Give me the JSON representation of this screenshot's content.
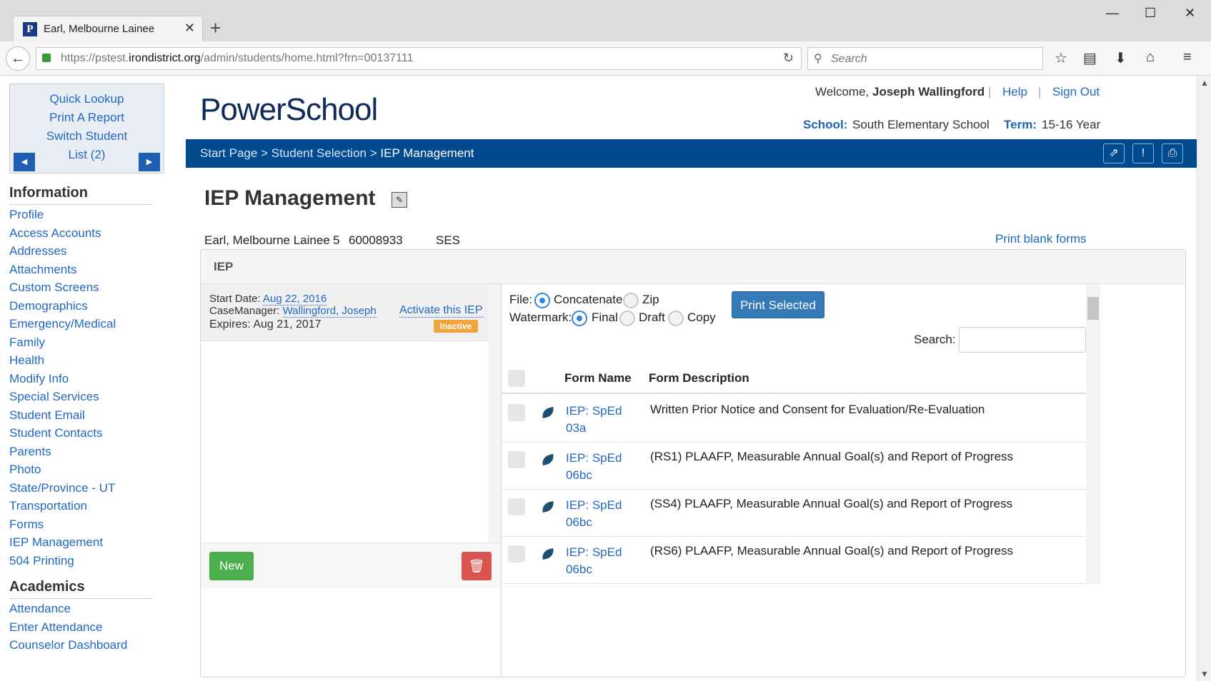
{
  "browser": {
    "tab_title": "Earl, Melbourne Lainee",
    "url_prefix": "https://pstest.",
    "url_domain": "irondistrict.org",
    "url_path": "/admin/students/home.html?frn=00137111",
    "search_placeholder": "Search"
  },
  "sidebar": {
    "quick_lookup": "Quick Lookup",
    "print_report": "Print A Report",
    "switch_student": "Switch Student",
    "list": "List (2)",
    "information_heading": "Information",
    "information_links": [
      "Profile",
      "Access Accounts",
      "Addresses",
      "Attachments",
      "Custom Screens",
      "Demographics",
      "Emergency/Medical",
      "Family",
      "Health",
      "Modify Info",
      "Special Services",
      "Student Email",
      "Student Contacts",
      "Parents",
      "Photo",
      "State/Province - UT",
      "Transportation",
      "Forms",
      "IEP Management",
      "504 Printing"
    ],
    "academics_heading": "Academics",
    "academics_links": [
      "Attendance",
      "Enter Attendance",
      "Counselor Dashboard"
    ]
  },
  "header": {
    "logo": "PowerSchool",
    "welcome": "Welcome,",
    "user": "Joseph Wallingford",
    "help": "Help",
    "sign_out": "Sign Out",
    "school_label": "School:",
    "school_value": "South Elementary School",
    "term_label": "Term:",
    "term_value": "15-16 Year"
  },
  "breadcrumb": {
    "start": "Start Page",
    "selection": "Student Selection",
    "current": "IEP Management",
    "sep": ">"
  },
  "page": {
    "title": "IEP Management",
    "student_name": "Earl, Melbourne Lainee",
    "grade": "5",
    "student_number": "60008933",
    "school_abbr": "SES",
    "print_blank": "Print blank forms",
    "panel_title": "IEP"
  },
  "iep": {
    "start_label": "Start Date:",
    "start_value": "Aug 22, 2016",
    "cm_label": "CaseManager:",
    "cm_value": "Wallingford, Joseph",
    "expires": "Expires: Aug 21, 2017",
    "activate": "Activate this IEP",
    "status": "Inactive",
    "new_button": "New"
  },
  "options": {
    "file_label": "File:",
    "concatenate": "Concatenate",
    "zip": "Zip",
    "watermark_label": "Watermark:",
    "final": "Final",
    "draft": "Draft",
    "copy": "Copy",
    "print_selected": "Print Selected",
    "search_label": "Search:"
  },
  "table": {
    "col_name": "Form Name",
    "col_desc": "Form Description",
    "rows": [
      {
        "name": "IEP: SpEd 03a",
        "desc": "Written Prior Notice and Consent for Evaluation/Re-Evaluation"
      },
      {
        "name": "IEP: SpEd 06bc",
        "desc": "(RS1) PLAAFP, Measurable Annual Goal(s) and Report of Progress"
      },
      {
        "name": "IEP: SpEd 06bc",
        "desc": "(SS4) PLAAFP, Measurable Annual Goal(s) and Report of Progress"
      },
      {
        "name": "IEP: SpEd 06bc",
        "desc": "(RS6) PLAAFP, Measurable Annual Goal(s) and Report of Progress"
      }
    ]
  },
  "colors": {
    "brand_blue": "#004a8f",
    "link_blue": "#2168c5",
    "new_green": "#4cae4c",
    "delete_red": "#d9534f",
    "badge_orange": "#f0a439"
  }
}
